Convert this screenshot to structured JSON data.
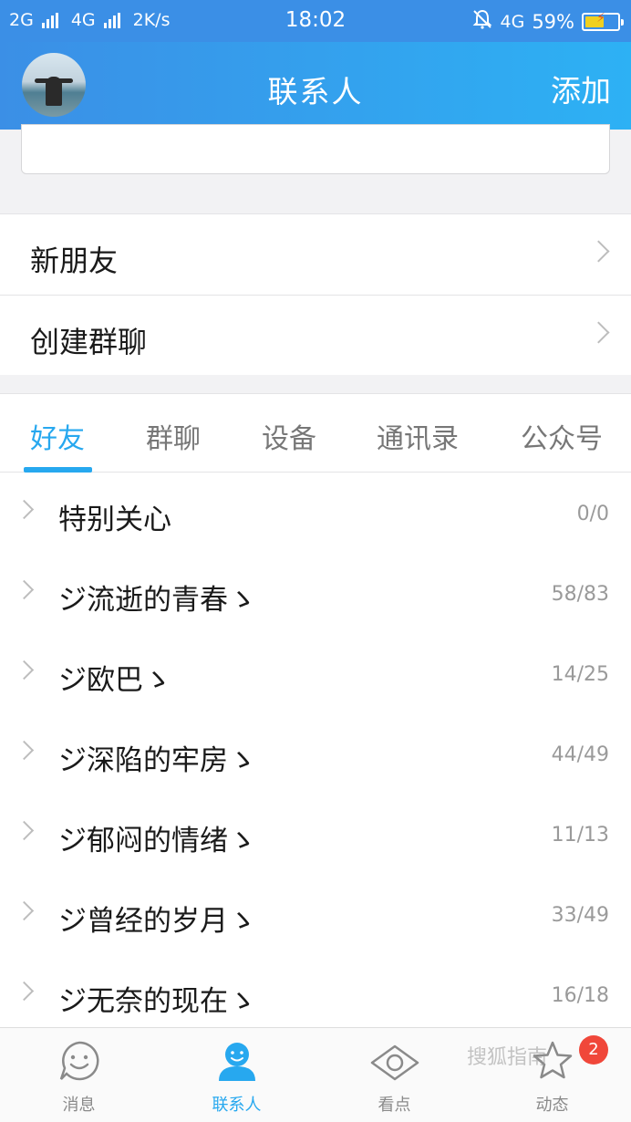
{
  "status_bar": {
    "network1": "2G",
    "network2": "4G",
    "speed": "2K/s",
    "time": "18:02",
    "network3": "4G",
    "battery": "59%",
    "battery_level": 0.59,
    "icons": [
      "signal-icon",
      "alarm-off-icon",
      "battery-icon"
    ]
  },
  "header": {
    "title": "联系人",
    "add_label": "添加"
  },
  "search": {
    "placeholder": ""
  },
  "menu": [
    {
      "label": "新朋友"
    },
    {
      "label": "创建群聊"
    }
  ],
  "tabs": [
    {
      "label": "好友",
      "active": true
    },
    {
      "label": "群聊"
    },
    {
      "label": "设备"
    },
    {
      "label": "通讯录"
    },
    {
      "label": "公众号"
    }
  ],
  "groups": [
    {
      "name": "特别关心",
      "count": "0/0"
    },
    {
      "name": "ジ流逝的青春ゝ",
      "count": "58/83"
    },
    {
      "name": "ジ欧巴ゝ",
      "count": "14/25"
    },
    {
      "name": "ジ深陷的牢房ゝ",
      "count": "44/49"
    },
    {
      "name": "ジ郁闷的情绪ゝ",
      "count": "11/13"
    },
    {
      "name": "ジ曾经的岁月ゝ",
      "count": "33/49"
    },
    {
      "name": "ジ无奈的现在ゝ",
      "count": "16/18"
    }
  ],
  "bottom_nav": [
    {
      "label": "消息",
      "icon": "message-icon"
    },
    {
      "label": "联系人",
      "icon": "contacts-icon",
      "active": true
    },
    {
      "label": "看点",
      "icon": "eye-icon"
    },
    {
      "label": "动态",
      "icon": "star-icon",
      "badge": "2"
    }
  ],
  "watermark": "搜狐指南",
  "colors": {
    "accent": "#27a8ef",
    "header_start": "#3b8fe6",
    "header_end": "#2db1f4",
    "badge": "#f0473a"
  }
}
